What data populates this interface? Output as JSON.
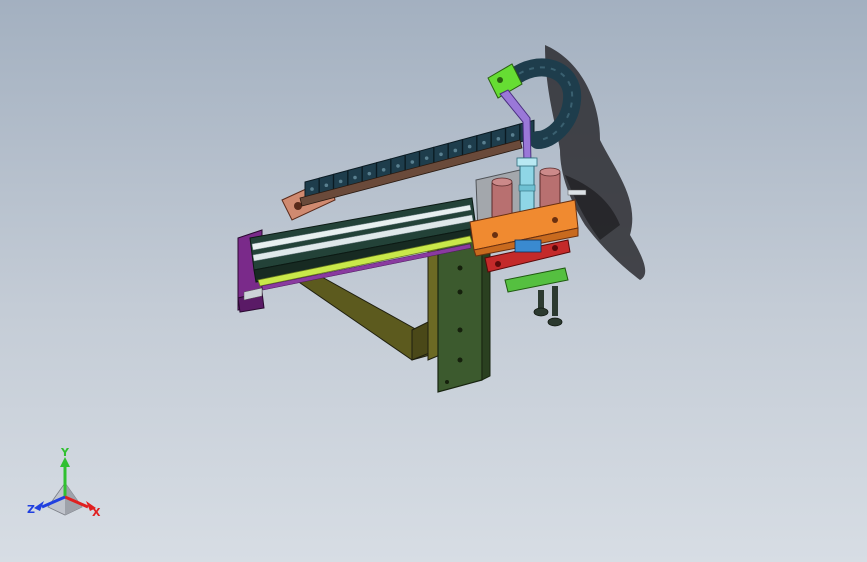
{
  "viewport": {
    "background_top": "#a3b0c0",
    "background_bottom": "#d7dde4"
  },
  "model": {
    "parts": [
      {
        "name": "cable-chain",
        "color": "#1e3d4c"
      },
      {
        "name": "chain-bracket",
        "color": "#d08a70"
      },
      {
        "name": "chain-end-mount",
        "color": "#66dd33"
      },
      {
        "name": "linear-rail",
        "color": "#234238"
      },
      {
        "name": "rail-end-plate",
        "color": "#7a2a8a"
      },
      {
        "name": "ball-screw",
        "color": "#c9e84a"
      },
      {
        "name": "support-arm",
        "color": "#5c5a1e"
      },
      {
        "name": "mounting-column",
        "color": "#3c5a2e"
      },
      {
        "name": "slide-carriage",
        "color": "#f08a30"
      },
      {
        "name": "guide-cylinder",
        "color": "#b87070"
      },
      {
        "name": "lift-shaft",
        "color": "#8fd6e6"
      },
      {
        "name": "link-arm",
        "color": "#9a78d8"
      },
      {
        "name": "clamp-plate",
        "color": "#c42a2a"
      },
      {
        "name": "suction-plate",
        "color": "#55c040"
      },
      {
        "name": "suction-cup",
        "color": "#2c3a30"
      }
    ]
  },
  "triad": {
    "x_label": "X",
    "y_label": "Y",
    "z_label": "Z",
    "x_color": "#e02020",
    "y_color": "#30c030",
    "z_color": "#2040e0"
  }
}
